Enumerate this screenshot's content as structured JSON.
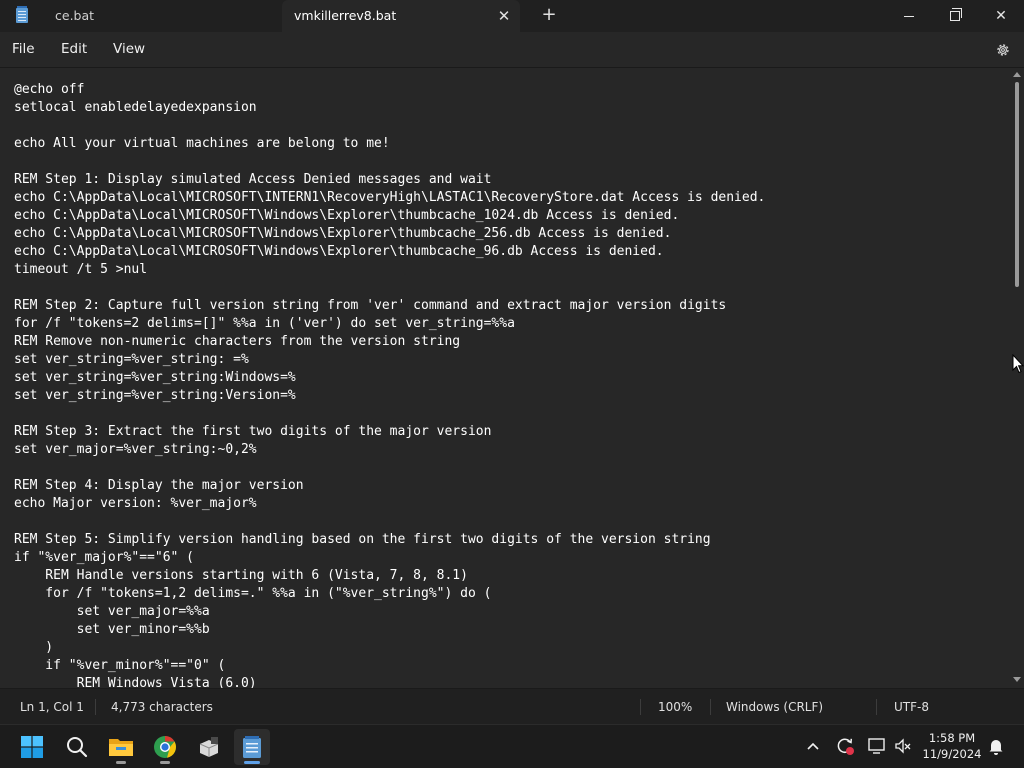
{
  "window": {
    "tabs": [
      {
        "label": "ce.bat",
        "active": false
      },
      {
        "label": "vmkillerrev8.bat",
        "active": true
      }
    ],
    "close_tab_glyph": "✕",
    "new_tab_glyph": "+",
    "close_window_glyph": "✕"
  },
  "menu": {
    "file": "File",
    "edit": "Edit",
    "view": "View",
    "settings_icon": "gear-icon"
  },
  "editor": {
    "lines": [
      "@echo off",
      "setlocal enabledelayedexpansion",
      "",
      "echo All your virtual machines are belong to me!",
      "",
      "REM Step 1: Display simulated Access Denied messages and wait",
      "echo C:\\AppData\\Local\\MICROSOFT\\INTERN1\\RecoveryHigh\\LASTAC1\\RecoveryStore.dat Access is denied.",
      "echo C:\\AppData\\Local\\MICROSOFT\\Windows\\Explorer\\thumbcache_1024.db Access is denied.",
      "echo C:\\AppData\\Local\\MICROSOFT\\Windows\\Explorer\\thumbcache_256.db Access is denied.",
      "echo C:\\AppData\\Local\\MICROSOFT\\Windows\\Explorer\\thumbcache_96.db Access is denied.",
      "timeout /t 5 >nul",
      "",
      "REM Step 2: Capture full version string from 'ver' command and extract major version digits",
      "for /f \"tokens=2 delims=[]\" %%a in ('ver') do set ver_string=%%a",
      "REM Remove non-numeric characters from the version string",
      "set ver_string=%ver_string: =%",
      "set ver_string=%ver_string:Windows=%",
      "set ver_string=%ver_string:Version=%",
      "",
      "REM Step 3: Extract the first two digits of the major version",
      "set ver_major=%ver_string:~0,2%",
      "",
      "REM Step 4: Display the major version",
      "echo Major version: %ver_major%",
      "",
      "REM Step 5: Simplify version handling based on the first two digits of the version string",
      "if \"%ver_major%\"==\"6\" (",
      "    REM Handle versions starting with 6 (Vista, 7, 8, 8.1)",
      "    for /f \"tokens=1,2 delims=.\" %%a in (\"%ver_string%\") do (",
      "        set ver_major=%%a",
      "        set ver_minor=%%b",
      "    )",
      "    if \"%ver_minor%\"==\"0\" (",
      "        REM Windows Vista (6.0)"
    ]
  },
  "status": {
    "position": "Ln 1, Col 1",
    "characters": "4,773 characters",
    "zoom": "100%",
    "line_endings": "Windows (CRLF)",
    "encoding": "UTF-8"
  },
  "taskbar": {
    "clock_time": "1:58 PM",
    "clock_date": "11/9/2024"
  },
  "colors": {
    "editor_bg": "#272727",
    "chrome_bg": "#202020",
    "accent": "#5ea0e8"
  }
}
